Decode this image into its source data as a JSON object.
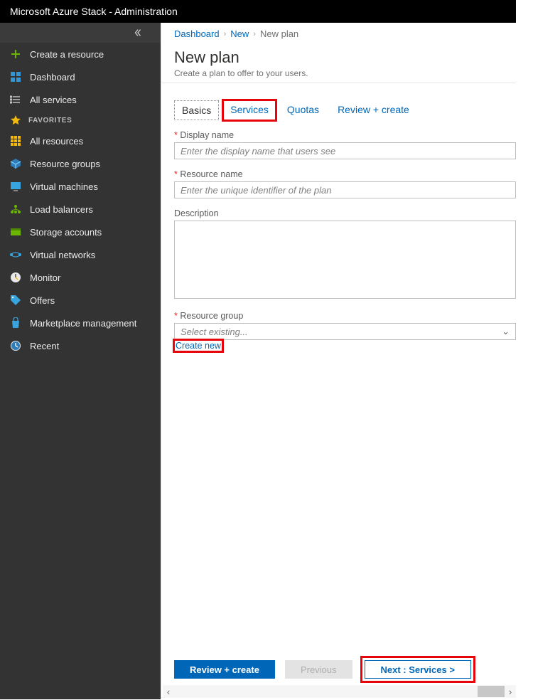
{
  "titlebar": "Microsoft Azure Stack - Administration",
  "sidebar": {
    "create": "Create a resource",
    "dashboard": "Dashboard",
    "all_services": "All services",
    "favorites_label": "FAVORITES",
    "items": [
      {
        "label": "All resources"
      },
      {
        "label": "Resource groups"
      },
      {
        "label": "Virtual machines"
      },
      {
        "label": "Load balancers"
      },
      {
        "label": "Storage accounts"
      },
      {
        "label": "Virtual networks"
      },
      {
        "label": "Monitor"
      },
      {
        "label": "Offers"
      },
      {
        "label": "Marketplace management"
      },
      {
        "label": "Recent"
      }
    ]
  },
  "breadcrumb": {
    "a": "Dashboard",
    "b": "New",
    "c": "New plan"
  },
  "page": {
    "title": "New plan",
    "subtitle": "Create a plan to offer to your users."
  },
  "tabs": {
    "basics": "Basics",
    "services": "Services",
    "quotas": "Quotas",
    "review": "Review + create"
  },
  "fields": {
    "display_name_label": "Display name",
    "display_name_ph": "Enter the display name that users see",
    "resource_name_label": "Resource name",
    "resource_name_ph": "Enter the unique identifier of the plan",
    "description_label": "Description",
    "resource_group_label": "Resource group",
    "resource_group_ph": "Select existing...",
    "create_new": "Create new"
  },
  "footer": {
    "review": "Review + create",
    "previous": "Previous",
    "next": "Next : Services >"
  }
}
